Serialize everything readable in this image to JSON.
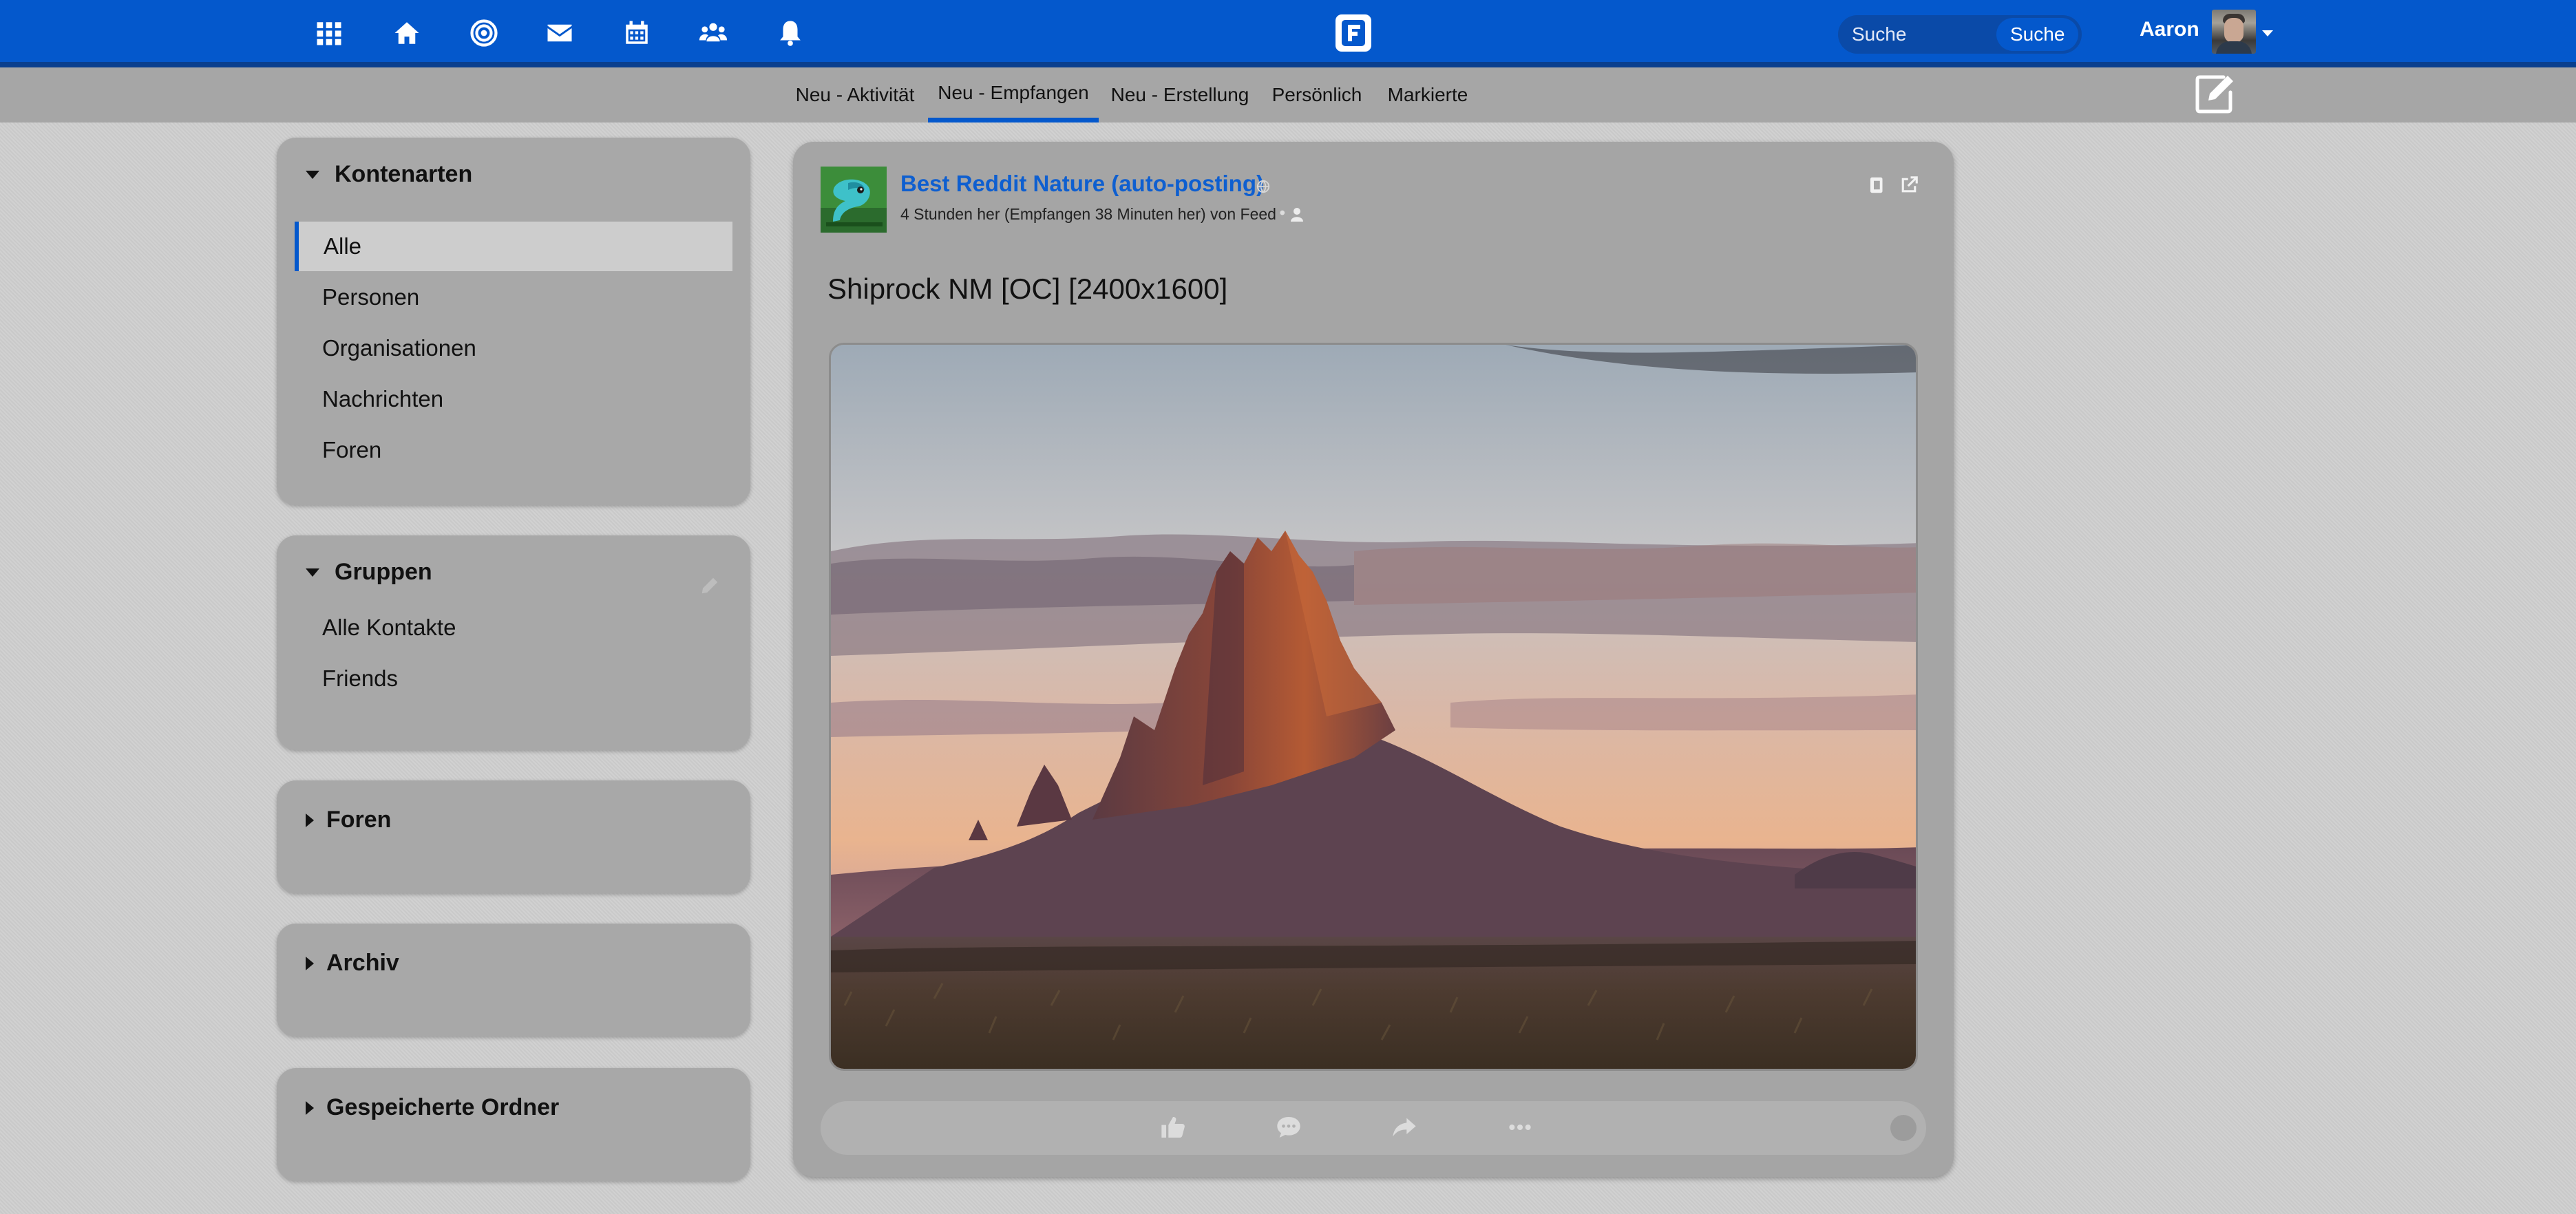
{
  "topbar": {
    "icons": [
      "apps-grid-icon",
      "home-icon",
      "network-icon",
      "mail-icon",
      "calendar-icon",
      "contacts-icon",
      "bell-icon"
    ],
    "logo": "friendica-logo",
    "search": {
      "placeholder": "Suche",
      "button_label": "Suche"
    },
    "user": {
      "name": "Aaron"
    },
    "colors": {
      "bar": "#0458cc",
      "accent": "#0e5fd0"
    }
  },
  "tabs": [
    {
      "label": "Neu - Aktivität",
      "active": false
    },
    {
      "label": "Neu - Empfangen",
      "active": true
    },
    {
      "label": "Neu - Erstellung",
      "active": false
    },
    {
      "label": "Persönlich",
      "active": false
    },
    {
      "label": "Markierte",
      "active": false
    }
  ],
  "sidebar": {
    "account_types": {
      "title": "Kontenarten",
      "items": [
        {
          "label": "Alle",
          "active": true
        },
        {
          "label": "Personen",
          "active": false
        },
        {
          "label": "Organisationen",
          "active": false
        },
        {
          "label": "Nachrichten",
          "active": false
        },
        {
          "label": "Foren",
          "active": false
        }
      ]
    },
    "groups": {
      "title": "Gruppen",
      "items": [
        {
          "label": "Alle Kontakte"
        },
        {
          "label": "Friends"
        }
      ]
    },
    "forums": {
      "title": "Foren"
    },
    "archive": {
      "title": "Archiv"
    },
    "saved_folders": {
      "title": "Gespeicherte Ordner"
    }
  },
  "post": {
    "author": "Best Reddit Nature (auto-posting)",
    "meta": "4 Stunden her (Empfangen 38 Minuten her) von Feed",
    "title": "Shiprock NM [OC] [2400x1600]",
    "actions": [
      "like-icon",
      "comment-icon",
      "share-icon",
      "more-icon"
    ]
  }
}
